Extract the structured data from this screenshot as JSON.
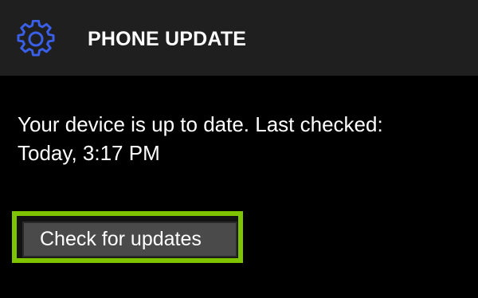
{
  "header": {
    "title": "PHONE UPDATE",
    "icon": "gear-icon",
    "icon_color": "#3a5fe8"
  },
  "status": {
    "line1": "Your device is up to date. Last checked:",
    "line2": "Today, 3:17 PM"
  },
  "actions": {
    "check_label": "Check for updates",
    "highlight_color": "#7fc400"
  }
}
